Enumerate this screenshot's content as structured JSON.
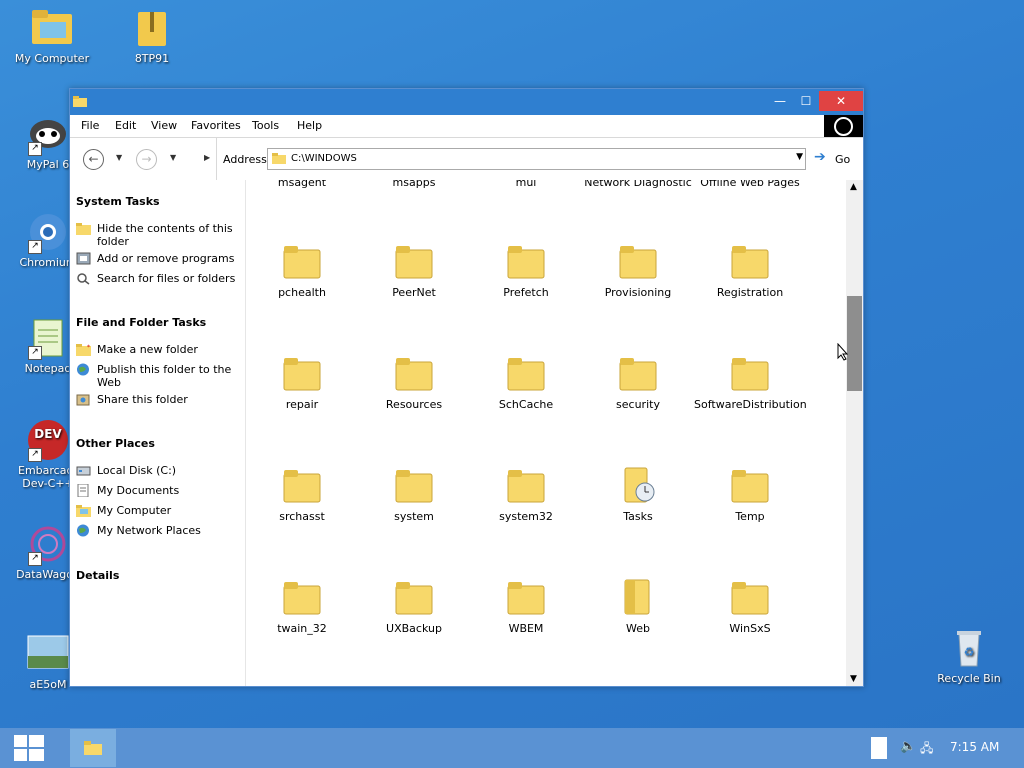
{
  "desktop": {
    "icons": [
      {
        "label": "My Computer"
      },
      {
        "label": "8TP91"
      },
      {
        "label": "MyPal 6"
      },
      {
        "label": "Chromium"
      },
      {
        "label": "Notepad"
      },
      {
        "label": "Embarcadero Dev-C++"
      },
      {
        "label": "DataWagon"
      },
      {
        "label": "aE5oM"
      },
      {
        "label": "Recycle Bin"
      }
    ]
  },
  "window": {
    "menu": [
      "File",
      "Edit",
      "View",
      "Favorites",
      "Tools",
      "Help"
    ],
    "address_label": "Address",
    "address_value": "C:\\WINDOWS",
    "go_label": "Go",
    "system_tasks": {
      "title": "System Tasks",
      "items": [
        "Hide the contents of this folder",
        "Add or remove programs",
        "Search for files or folders"
      ]
    },
    "file_tasks": {
      "title": "File and Folder Tasks",
      "items": [
        "Make a new folder",
        "Publish this folder to the Web",
        "Share this folder"
      ]
    },
    "other_places": {
      "title": "Other Places",
      "items": [
        "Local Disk (C:)",
        "My Documents",
        "My Computer",
        "My Network Places"
      ]
    },
    "details_title": "Details",
    "folders": [
      "msagent",
      "msapps",
      "mui",
      "Network Diagnostic",
      "Offline Web Pages",
      "pchealth",
      "PeerNet",
      "Prefetch",
      "Provisioning",
      "Registration",
      "repair",
      "Resources",
      "SchCache",
      "security",
      "SoftwareDistribution",
      "srchasst",
      "system",
      "system32",
      "Tasks",
      "Temp",
      "twain_32",
      "UXBackup",
      "WBEM",
      "Web",
      "WinSxS"
    ]
  },
  "taskbar": {
    "clock": "7:15 AM"
  },
  "colors": {
    "desktop": "#2f7fd0",
    "title_bar": "#2f7fd0",
    "close_button": "#e04343",
    "taskbar": "#5a92d3",
    "folder": "#f7d86a"
  }
}
